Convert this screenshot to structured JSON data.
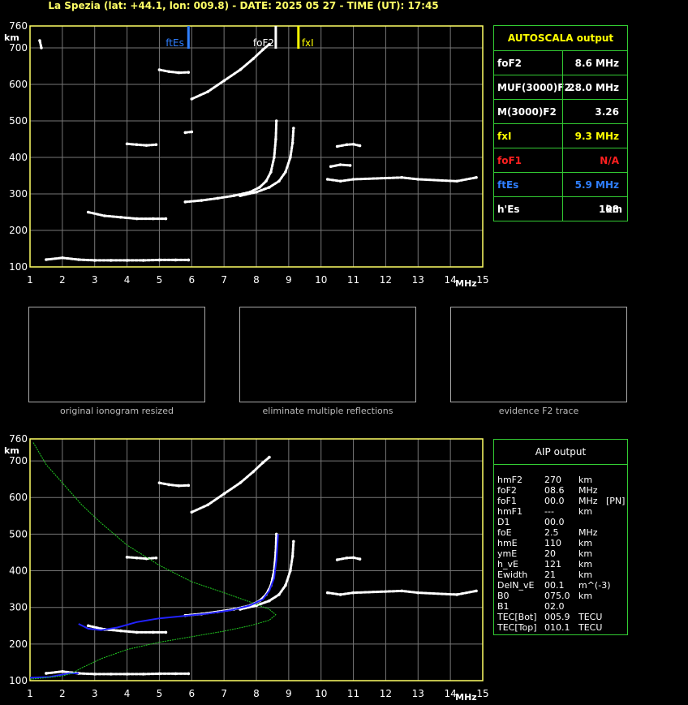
{
  "header": {
    "title": "La Spezia (lat: +44.1, lon: 009.8) - DATE: 2025 05 27 - TIME (UT): 17:45"
  },
  "colors": {
    "axis": "#ffff66",
    "grid": "#777777",
    "panel_border": "#33cc33",
    "ftEs": "#2f7fff",
    "foF2": "#ffffff",
    "fxI": "#ffff00",
    "foF1": "#ff2020",
    "model": "#22cc22",
    "trace": "#2222ff"
  },
  "plot_labels": {
    "km": "km",
    "mhz": "MHz"
  },
  "markers": [
    {
      "label": "ftEs",
      "freq": 5.9,
      "color": "#2f7fff"
    },
    {
      "label": "foF2",
      "freq": 8.6,
      "color": "#ffffff"
    },
    {
      "label": "fxI",
      "freq": 9.3,
      "color": "#ffff00"
    }
  ],
  "autoscala": {
    "title": "AUTOSCALA output",
    "rows": [
      {
        "label": "foF2",
        "value": "8.6 MHz",
        "unit": "",
        "color": "#ffffff"
      },
      {
        "label": "MUF(3000)F2",
        "value": "28.0 MHz",
        "unit": "",
        "color": "#ffffff"
      },
      {
        "label": "M(3000)F2",
        "value": "3.26",
        "unit": "",
        "color": "#ffffff"
      },
      {
        "label": "fxI",
        "value": "9.3 MHz",
        "unit": "",
        "color": "#ffff00"
      },
      {
        "label": "foF1",
        "value": "N/A",
        "unit": "",
        "color": "#ff2020"
      },
      {
        "label": "ftEs",
        "value": "5.9 MHz",
        "unit": "",
        "color": "#2f7fff"
      },
      {
        "label": "h'Es",
        "value": "108",
        "unit": "km",
        "color": "#ffffff"
      }
    ]
  },
  "aip": {
    "title": "AIP output",
    "rows": [
      {
        "name": "hmF2",
        "value": "270",
        "unit": "km",
        "extra": ""
      },
      {
        "name": "foF2",
        "value": "08.6",
        "unit": "MHz",
        "extra": ""
      },
      {
        "name": "foF1",
        "value": "00.0",
        "unit": "MHz",
        "extra": "[PN]"
      },
      {
        "name": "hmF1",
        "value": "---",
        "unit": "km",
        "extra": ""
      },
      {
        "name": "D1",
        "value": "00.0",
        "unit": "",
        "extra": ""
      },
      {
        "name": "foE",
        "value": "2.5",
        "unit": "MHz",
        "extra": ""
      },
      {
        "name": "hmE",
        "value": "110",
        "unit": "km",
        "extra": ""
      },
      {
        "name": "ymE",
        "value": "20",
        "unit": "km",
        "extra": ""
      },
      {
        "name": "h_vE",
        "value": "121",
        "unit": "km",
        "extra": ""
      },
      {
        "name": "Ewidth",
        "value": "21",
        "unit": "km",
        "extra": ""
      },
      {
        "name": "DelN_vE",
        "value": "00.1",
        "unit": "m^(-3)",
        "extra": ""
      },
      {
        "name": "B0",
        "value": "075.0",
        "unit": "km",
        "extra": ""
      },
      {
        "name": "B1",
        "value": "02.0",
        "unit": "",
        "extra": ""
      },
      {
        "name": "TEC[Bot]",
        "value": "005.9",
        "unit": "TECU",
        "extra": ""
      },
      {
        "name": "TEC[Top]",
        "value": "010.1",
        "unit": "TECU",
        "extra": ""
      }
    ]
  },
  "thumbnails": [
    {
      "caption": "original ionogram resized"
    },
    {
      "caption": "eliminate multiple reflections"
    },
    {
      "caption": "evidence F2 trace"
    }
  ],
  "chart_data": [
    {
      "type": "scatter",
      "title": "",
      "xlabel": "MHz",
      "ylabel": "km",
      "xlim": [
        1,
        15
      ],
      "ylim": [
        100,
        760
      ],
      "x_ticks": [
        1,
        2,
        3,
        4,
        5,
        6,
        7,
        8,
        9,
        10,
        11,
        12,
        13,
        14,
        15
      ],
      "y_ticks": [
        100,
        200,
        300,
        400,
        500,
        600,
        700,
        760
      ],
      "grid": true,
      "series": [
        {
          "points": [
            [
              1.5,
              120
            ],
            [
              2.0,
              125
            ],
            [
              2.5,
              120
            ],
            [
              3.0,
              118
            ],
            [
              3.5,
              118
            ],
            [
              4.0,
              118
            ],
            [
              4.5,
              118
            ],
            [
              5.0,
              119
            ],
            [
              5.5,
              119
            ],
            [
              5.9,
              119
            ]
          ]
        },
        {
          "points": [
            [
              5.8,
              278
            ],
            [
              6.3,
              282
            ],
            [
              6.8,
              288
            ],
            [
              7.3,
              295
            ],
            [
              7.8,
              305
            ],
            [
              8.1,
              318
            ],
            [
              8.3,
              335
            ],
            [
              8.45,
              360
            ],
            [
              8.55,
              400
            ],
            [
              8.6,
              450
            ],
            [
              8.62,
              500
            ]
          ]
        },
        {
          "points": [
            [
              7.5,
              295
            ],
            [
              8.0,
              305
            ],
            [
              8.4,
              318
            ],
            [
              8.7,
              335
            ],
            [
              8.9,
              360
            ],
            [
              9.05,
              400
            ],
            [
              9.12,
              440
            ],
            [
              9.15,
              480
            ]
          ]
        },
        {
          "points": [
            [
              6.0,
              560
            ],
            [
              6.5,
              580
            ],
            [
              7.0,
              610
            ],
            [
              7.5,
              640
            ],
            [
              7.9,
              670
            ],
            [
              8.2,
              695
            ],
            [
              8.4,
              710
            ]
          ]
        },
        {
          "points": [
            [
              5.0,
              640
            ],
            [
              5.3,
              635
            ],
            [
              5.6,
              632
            ],
            [
              5.9,
              633
            ]
          ]
        },
        {
          "points": [
            [
              4.0,
              437
            ],
            [
              4.3,
              435
            ],
            [
              4.6,
              433
            ],
            [
              4.9,
              435
            ]
          ]
        },
        {
          "points": [
            [
              5.8,
              468
            ],
            [
              6.0,
              470
            ]
          ]
        },
        {
          "points": [
            [
              2.8,
              250
            ],
            [
              3.3,
              240
            ],
            [
              3.8,
              236
            ],
            [
              4.3,
              232
            ],
            [
              4.8,
              232
            ],
            [
              5.2,
              232
            ]
          ]
        },
        {
          "points": [
            [
              1.3,
              720
            ],
            [
              1.35,
              700
            ]
          ]
        },
        {
          "points": [
            [
              10.5,
              430
            ],
            [
              10.8,
              435
            ],
            [
              11.0,
              436
            ],
            [
              11.2,
              432
            ]
          ]
        },
        {
          "points": [
            [
              10.3,
              375
            ],
            [
              10.6,
              380
            ],
            [
              10.9,
              378
            ]
          ]
        },
        {
          "points": [
            [
              10.2,
              340
            ],
            [
              10.6,
              335
            ],
            [
              11.0,
              340
            ],
            [
              12.5,
              345
            ],
            [
              13.0,
              340
            ],
            [
              14.2,
              335
            ],
            [
              14.8,
              345
            ]
          ]
        }
      ]
    },
    {
      "type": "line",
      "title": "",
      "xlabel": "MHz",
      "ylabel": "km",
      "xlim": [
        1,
        15
      ],
      "ylim": [
        100,
        760
      ],
      "x_ticks": [
        1,
        2,
        3,
        4,
        5,
        6,
        7,
        8,
        9,
        10,
        11,
        12,
        13,
        14,
        15
      ],
      "y_ticks": [
        100,
        200,
        300,
        400,
        500,
        600,
        700,
        760
      ],
      "grid": true,
      "series": [
        {
          "points": [
            [
              1.5,
              120
            ],
            [
              2.0,
              125
            ],
            [
              2.5,
              120
            ],
            [
              3.0,
              118
            ],
            [
              3.5,
              118
            ],
            [
              4.0,
              118
            ],
            [
              4.5,
              118
            ],
            [
              5.0,
              119
            ],
            [
              5.5,
              119
            ],
            [
              5.9,
              119
            ]
          ]
        },
        {
          "points": [
            [
              5.8,
              278
            ],
            [
              6.3,
              282
            ],
            [
              6.8,
              288
            ],
            [
              7.3,
              295
            ],
            [
              7.8,
              305
            ],
            [
              8.1,
              318
            ],
            [
              8.3,
              335
            ],
            [
              8.45,
              360
            ],
            [
              8.55,
              400
            ],
            [
              8.6,
              450
            ],
            [
              8.62,
              500
            ]
          ]
        },
        {
          "points": [
            [
              7.5,
              295
            ],
            [
              8.0,
              305
            ],
            [
              8.4,
              318
            ],
            [
              8.7,
              335
            ],
            [
              8.9,
              360
            ],
            [
              9.05,
              400
            ],
            [
              9.12,
              440
            ],
            [
              9.15,
              480
            ]
          ]
        },
        {
          "points": [
            [
              6.0,
              560
            ],
            [
              6.5,
              580
            ],
            [
              7.0,
              610
            ],
            [
              7.5,
              640
            ],
            [
              7.9,
              670
            ],
            [
              8.2,
              695
            ],
            [
              8.4,
              710
            ]
          ]
        },
        {
          "points": [
            [
              5.0,
              640
            ],
            [
              5.3,
              635
            ],
            [
              5.6,
              632
            ],
            [
              5.9,
              633
            ]
          ]
        },
        {
          "points": [
            [
              4.0,
              437
            ],
            [
              4.3,
              435
            ],
            [
              4.6,
              433
            ],
            [
              4.9,
              435
            ]
          ]
        },
        {
          "points": [
            [
              2.8,
              250
            ],
            [
              3.3,
              240
            ],
            [
              3.8,
              236
            ],
            [
              4.3,
              232
            ],
            [
              4.8,
              232
            ],
            [
              5.2,
              232
            ]
          ]
        },
        {
          "points": [
            [
              10.5,
              430
            ],
            [
              10.8,
              435
            ],
            [
              11.0,
              436
            ],
            [
              11.2,
              432
            ]
          ]
        },
        {
          "points": [
            [
              10.2,
              340
            ],
            [
              10.6,
              335
            ],
            [
              11.0,
              340
            ],
            [
              12.5,
              345
            ],
            [
              13.0,
              340
            ],
            [
              14.2,
              335
            ],
            [
              14.8,
              345
            ]
          ]
        },
        {
          "points": [
            [
              1.0,
              108
            ],
            [
              1.6,
              110
            ],
            [
              2.2,
              120
            ],
            [
              2.5,
              120
            ]
          ]
        },
        {
          "points": [
            [
              1.1,
              750
            ],
            [
              1.5,
              690
            ],
            [
              2.0,
              640
            ],
            [
              2.6,
              580
            ],
            [
              3.2,
              530
            ],
            [
              4.0,
              470
            ],
            [
              5.0,
              415
            ],
            [
              6.0,
              370
            ],
            [
              7.0,
              340
            ],
            [
              7.8,
              315
            ],
            [
              8.4,
              295
            ],
            [
              8.6,
              280
            ],
            [
              8.4,
              265
            ],
            [
              7.8,
              250
            ],
            [
              7.0,
              235
            ],
            [
              6.0,
              220
            ],
            [
              5.0,
              205
            ],
            [
              4.0,
              185
            ],
            [
              3.2,
              160
            ],
            [
              2.6,
              135
            ],
            [
              2.3,
              120
            ],
            [
              2.0,
              113
            ],
            [
              1.5,
              108
            ],
            [
              1.0,
              104
            ]
          ]
        },
        {
          "points": [
            [
              2.5,
              255
            ],
            [
              2.8,
              242
            ],
            [
              3.2,
              238
            ],
            [
              3.7,
              245
            ],
            [
              4.3,
              260
            ],
            [
              5.0,
              270
            ],
            [
              5.8,
              277
            ],
            [
              6.5,
              283
            ],
            [
              7.2,
              292
            ],
            [
              7.8,
              305
            ],
            [
              8.2,
              322
            ],
            [
              8.4,
              345
            ],
            [
              8.55,
              380
            ],
            [
              8.62,
              430
            ],
            [
              8.65,
              470
            ],
            [
              8.67,
              500
            ]
          ]
        }
      ]
    }
  ]
}
